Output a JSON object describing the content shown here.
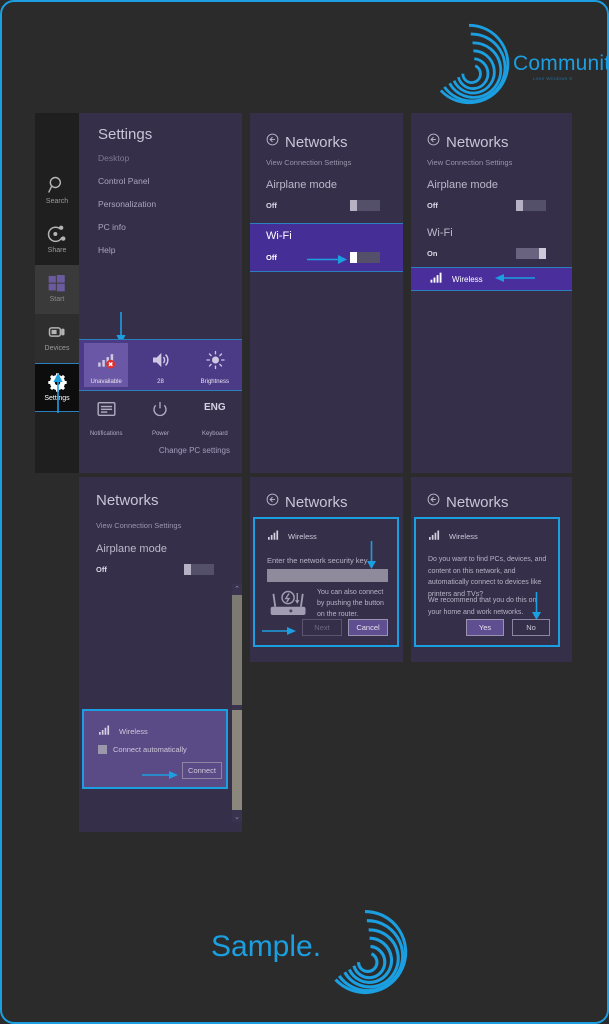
{
  "brand": {
    "title": "Community",
    "subtitle": "Love Windows 8",
    "accent": "#1b9fe0"
  },
  "footer": {
    "title": "Sample."
  },
  "charms": {
    "items": [
      {
        "label": "Search",
        "icon": "search-icon"
      },
      {
        "label": "Share",
        "icon": "share-icon"
      },
      {
        "label": "Start",
        "icon": "windows-icon"
      },
      {
        "label": "Devices",
        "icon": "devices-icon"
      },
      {
        "label": "Settings",
        "icon": "gear-icon"
      }
    ]
  },
  "settings_panel": {
    "title": "Settings",
    "items": [
      "Desktop",
      "Control Panel",
      "Personalization",
      "PC info",
      "Help"
    ],
    "quick_tiles": [
      {
        "label": "Unavailable",
        "icon": "wifi-unavailable-icon"
      },
      {
        "label": "28",
        "icon": "volume-icon"
      },
      {
        "label": "Brightness",
        "icon": "brightness-icon"
      }
    ],
    "system_tiles": [
      {
        "label": "Notifications",
        "icon": "notifications-icon"
      },
      {
        "label": "Power",
        "icon": "power-icon"
      },
      {
        "label": "Keyboard",
        "icon": "ENG"
      }
    ],
    "change_pc_settings": "Change PC settings"
  },
  "networks_wifi_off": {
    "title": "Networks",
    "link": "View Connection Settings",
    "airplane_label": "Airplane mode",
    "airplane_state": "Off",
    "wifi_label": "Wi-Fi",
    "wifi_state": "Off"
  },
  "networks_wifi_on": {
    "title": "Networks",
    "link": "View Connection Settings",
    "airplane_label": "Airplane mode",
    "airplane_state": "Off",
    "wifi_label": "Wi-Fi",
    "wifi_state": "On",
    "network_name": "Wireless"
  },
  "networks_connect": {
    "title": "Networks",
    "link": "View Connection Settings",
    "airplane_label": "Airplane mode",
    "airplane_state": "Off",
    "flyout": {
      "network_name": "Wireless",
      "checkbox_label": "Connect automatically",
      "connect_button": "Connect"
    }
  },
  "networks_security_key": {
    "title": "Networks",
    "flyout": {
      "network_name": "Wireless",
      "prompt": "Enter the network security key",
      "key_value": "",
      "router_hint": "You can also connect by pushing the button on the router.",
      "next_button": "Next",
      "cancel_button": "Cancel"
    }
  },
  "networks_sharing": {
    "title": "Networks",
    "flyout": {
      "network_name": "Wireless",
      "question": "Do you want to find PCs, devices, and content on this network, and automatically connect to devices like printers and TVs?",
      "recommendation": "We recommend that you do this on your home and work networks.",
      "yes_button": "Yes",
      "no_button": "No"
    }
  }
}
